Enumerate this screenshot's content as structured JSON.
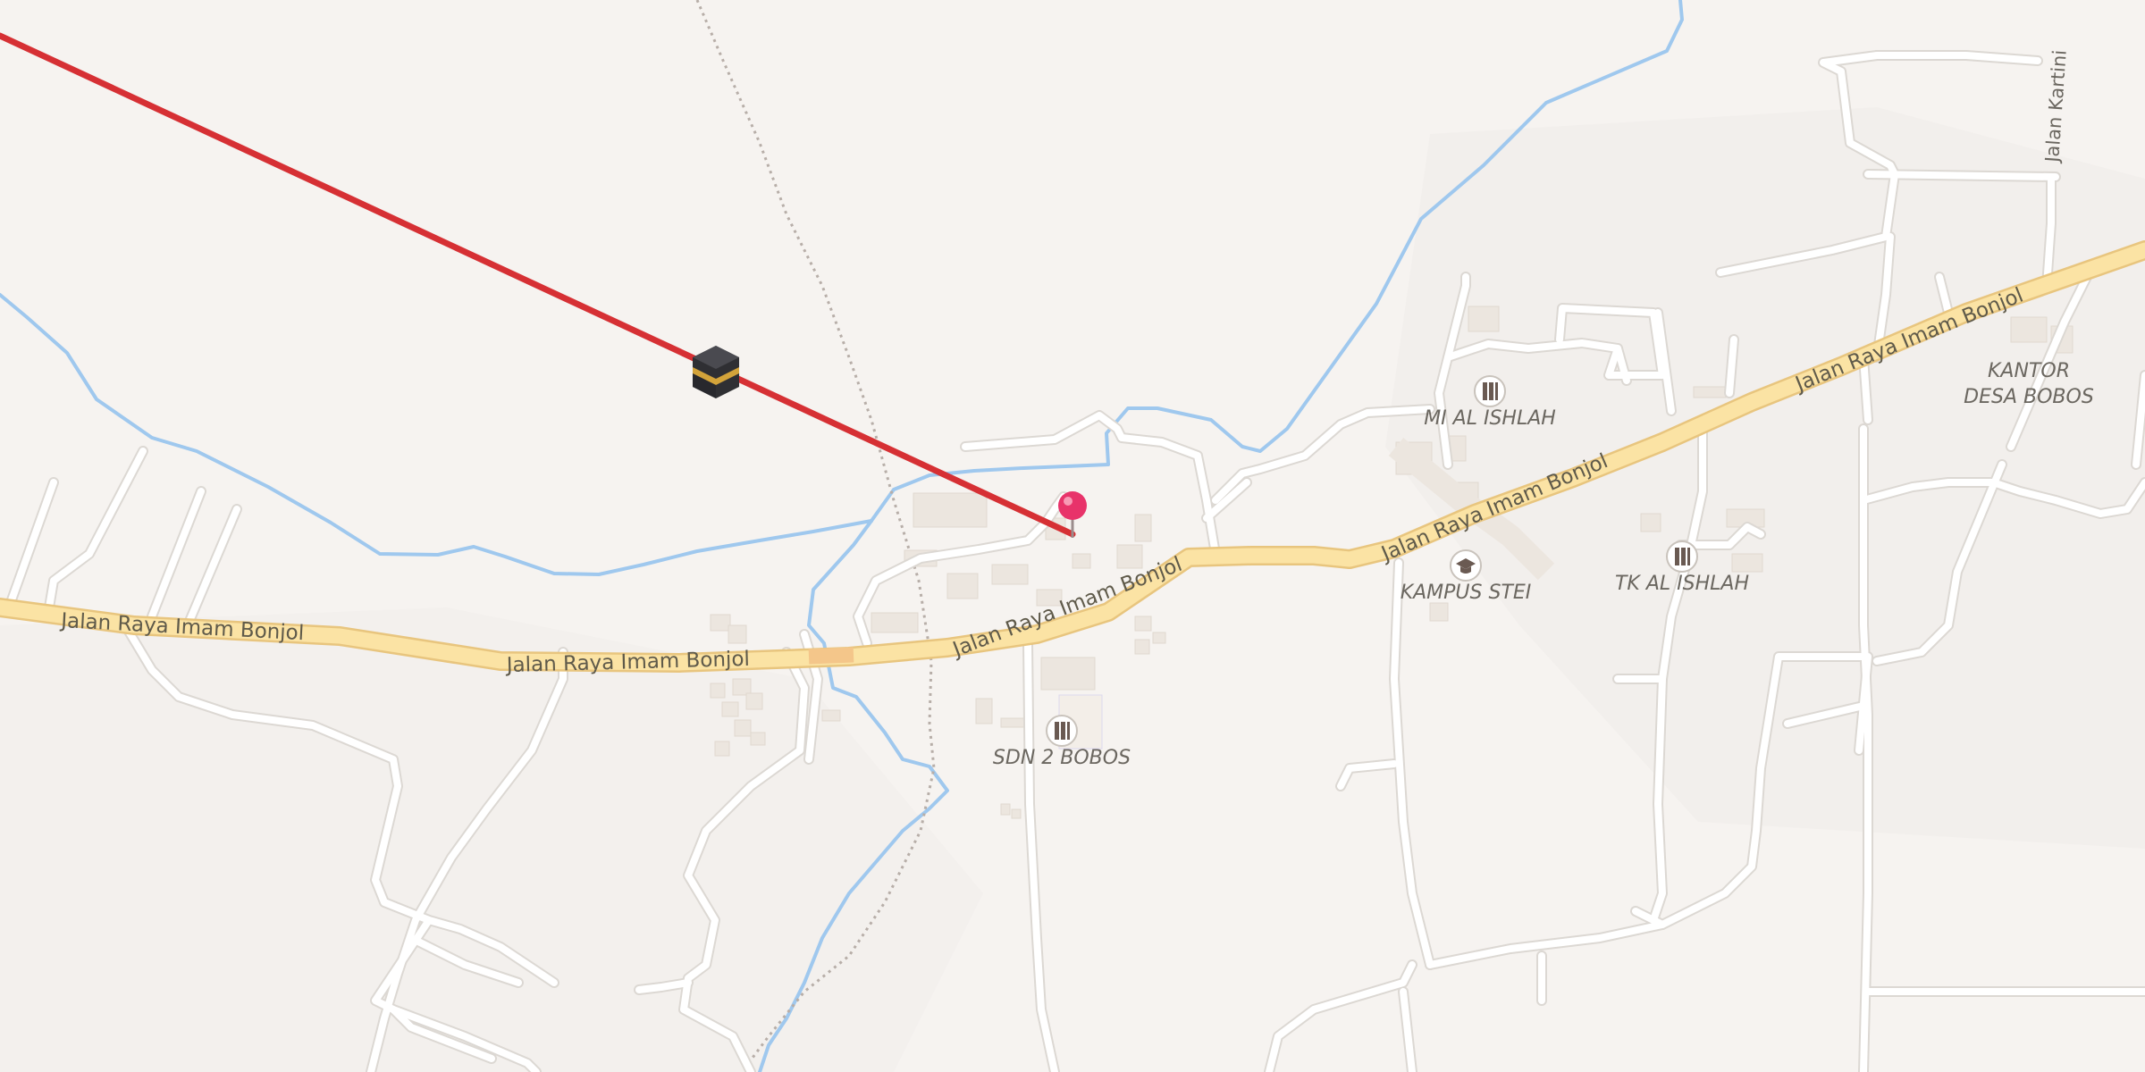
{
  "map": {
    "roads": {
      "main_road_labels": [
        "Jalan Raya Imam Bonjol",
        "Jalan Raya Imam Bonjol",
        "Jalan Raya Imam Bonjol",
        "Jalan Raya Imam Bonjol",
        "Jalan Raya Imam Bonjol"
      ],
      "street_kartini": "Jalan Kartini"
    },
    "pois": [
      {
        "label": "MI AL ISHLAH",
        "icon": "school-icon"
      },
      {
        "label": "KAMPUS STEI",
        "icon": "graduation-cap-icon"
      },
      {
        "label": "TK AL ISHLAH",
        "icon": "school-icon"
      },
      {
        "label": "SDN 2 BOBOS",
        "icon": "school-icon"
      },
      {
        "label_line1": "KANTOR",
        "label_line2": "DESA BOBOS"
      }
    ],
    "markers": {
      "location_pin": "map-pin-icon",
      "qibla_marker": "kaaba-icon"
    },
    "colors": {
      "background": "#f6f3f0",
      "main_road": "#fbe3a4",
      "main_road_casing": "#e8c57e",
      "minor_road": "#ffffff",
      "minor_road_casing": "#dcd8d3",
      "river": "#9fc8ee",
      "qibla_line": "#d63034",
      "pin": "#e8336a",
      "building": "#ece6df"
    }
  }
}
